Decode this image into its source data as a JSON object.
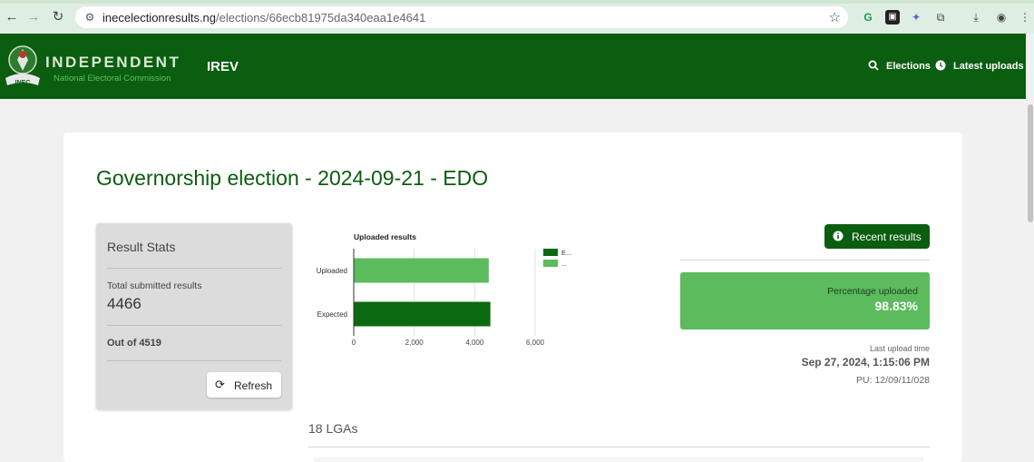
{
  "browser": {
    "url_domain": "inecelectionresults.ng",
    "url_path": "/elections/66ecb81975da340eaa1e4641"
  },
  "header": {
    "brand_title": "INDEPENDENT",
    "brand_subtitle": "National Electoral Commission",
    "logo_text": "INEC",
    "app_name": "IREV",
    "nav": [
      {
        "label": "Elections",
        "icon": "search-icon"
      },
      {
        "label": "Latest uploads",
        "icon": "clock-icon"
      }
    ]
  },
  "page": {
    "title": "Governorship election - 2024-09-21 - EDO"
  },
  "stats": {
    "title": "Result Stats",
    "total_label": "Total submitted results",
    "total_value": "4466",
    "out_of": "Out of 4519",
    "refresh_label": "Refresh"
  },
  "chart_data": {
    "type": "bar",
    "orientation": "horizontal",
    "title": "Uploaded results",
    "categories": [
      "Uploaded",
      "Expected"
    ],
    "values": [
      4466,
      4519
    ],
    "colors": [
      "#5cbb5c",
      "#0b6a10"
    ],
    "xlim": [
      0,
      6000
    ],
    "xticks": [
      "0",
      "2,000",
      "4,000",
      "6,000"
    ],
    "legend": [
      "E...",
      "..."
    ],
    "legend_colors": [
      "#0b6a10",
      "#5cbb5c"
    ],
    "legend_position": "right",
    "grid": true
  },
  "right": {
    "recent_label": "Recent results",
    "percentage_label": "Percentage uploaded",
    "percentage_value": "98.83%",
    "last_upload_label": "Last upload time",
    "last_upload_value": "Sep 27, 2024, 1:15:06 PM",
    "pu_code": "PU: 12/09/11/028"
  },
  "lga": {
    "count_label": "18 LGAs"
  },
  "colors": {
    "brand_green": "#0b5d10",
    "accent_green": "#5cbb5c"
  }
}
